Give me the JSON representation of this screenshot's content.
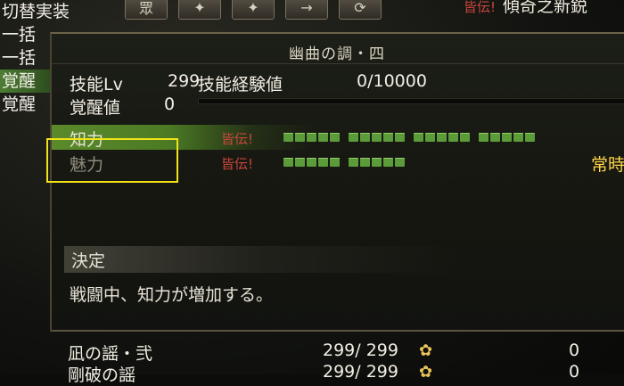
{
  "left_menu": {
    "items": [
      "切替実装",
      "一括",
      "一括",
      "覚醒",
      "覚醒"
    ]
  },
  "toolbar": {
    "buttons": [
      "眾",
      "✦",
      "✦",
      "→",
      "⟳"
    ]
  },
  "top_right": {
    "tag": "皆伝!",
    "text": "傾奇之新鋭"
  },
  "panel": {
    "title": "幽曲の調・四",
    "skill_lv_label": "技能Lv",
    "skill_lv_value": "299",
    "exp_label": "技能経験値",
    "exp_value": "0/10000",
    "awaken_label": "覚醒値",
    "awaken_value": "0",
    "stats": [
      {
        "name": "知力",
        "tag": "皆伝!",
        "pips": 20
      },
      {
        "name": "魅力",
        "tag": "皆伝!",
        "pips": 10,
        "right": "常時"
      }
    ],
    "section_title": "決定",
    "description": "戦闘中、知力が増加する。"
  },
  "list": [
    {
      "name": "凪の謡・弐",
      "value": "299/ 299",
      "zero": "0"
    },
    {
      "name": "剛破の謡",
      "value": "299/ 299",
      "zero": "0"
    }
  ],
  "colors": {
    "accent_green": "#5c9b3a",
    "highlight_yellow": "#f2e21a",
    "tag_red": "#c9473b",
    "gold": "#ffd64a"
  }
}
